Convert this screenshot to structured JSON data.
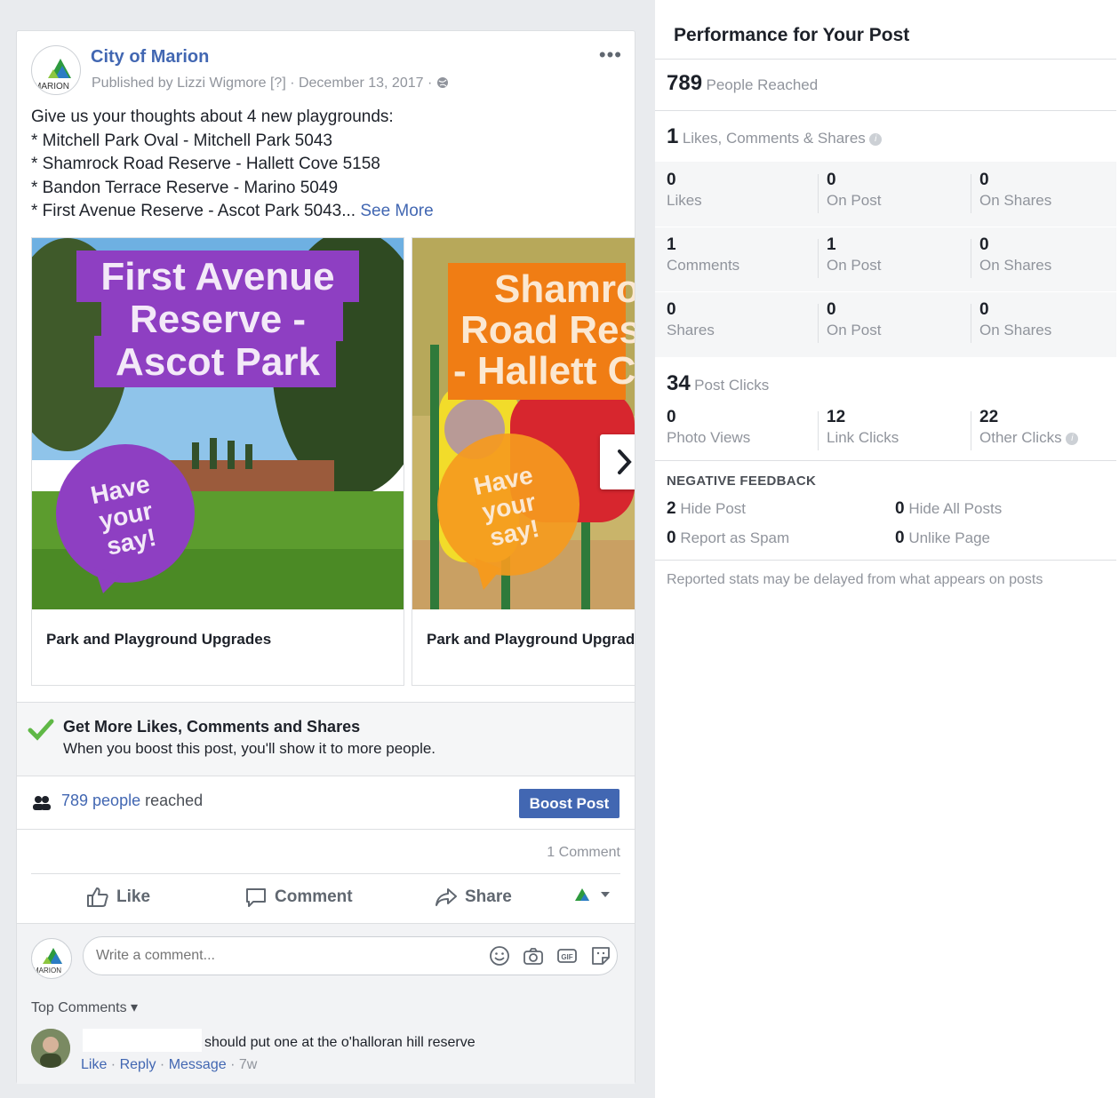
{
  "post": {
    "page_name": "City of Marion",
    "byline": "Published by Lizzi Wigmore [?] · December 13, 2017 ·",
    "avatar_text": "MARION",
    "menu_glyph": "•••",
    "body_lines": [
      "Give us your thoughts about 4 new playgrounds:",
      "* Mitchell Park Oval - Mitchell Park 5043",
      "* Shamrock Road Reserve - Hallett Cove 5158",
      "* Bandon Terrace Reserve - Marino 5049",
      "* First Avenue Reserve - Ascot Park 5043..."
    ],
    "see_more": "See More",
    "cards": [
      {
        "title_lines": [
          "First Avenue",
          "Reserve -",
          "Ascot Park"
        ],
        "bubble_lines": [
          "Have",
          "your",
          "say!"
        ],
        "caption": "Park and Playground Upgrades"
      },
      {
        "title_lines": [
          "Shamrock",
          "Road Reserve",
          "- Hallett Cove"
        ],
        "bubble_lines": [
          "Have",
          "your",
          "say!"
        ],
        "caption": "Park and Playground Upgrades"
      }
    ],
    "promo": {
      "title": "Get More Likes, Comments and Shares",
      "desc": "When you boost this post, you'll show it to more people."
    },
    "reach": {
      "link": "789 people",
      "suffix": " reached",
      "boost_label": "Boost Post"
    },
    "comment_count": "1 Comment",
    "actions": {
      "like": "Like",
      "comment": "Comment",
      "share": "Share"
    },
    "comment_input_placeholder": "Write a comment...",
    "top_comments": "Top Comments ▾",
    "comment": {
      "text": "should put one at the o'halloran hill reserve",
      "like": "Like",
      "reply": "Reply",
      "message": "Message",
      "age": "7w"
    },
    "colors": {
      "brand": "#4267b2",
      "card1_banner": "#8e3fc2",
      "card2_banner": "#f07d14",
      "check": "#5fb846"
    }
  },
  "performance": {
    "title": "Performance for Your Post",
    "reached": {
      "value": "789",
      "label": "People Reached"
    },
    "engagement": {
      "value": "1",
      "label": "Likes, Comments & Shares"
    },
    "rows": [
      {
        "a_num": "0",
        "a_lab": "Likes",
        "b_num": "0",
        "b_lab": "On Post",
        "c_num": "0",
        "c_lab": "On Shares"
      },
      {
        "a_num": "1",
        "a_lab": "Comments",
        "b_num": "1",
        "b_lab": "On Post",
        "c_num": "0",
        "c_lab": "On Shares"
      },
      {
        "a_num": "0",
        "a_lab": "Shares",
        "b_num": "0",
        "b_lab": "On Post",
        "c_num": "0",
        "c_lab": "On Shares"
      }
    ],
    "clicks": {
      "value": "34",
      "label": "Post Clicks"
    },
    "click_row": {
      "a_num": "0",
      "a_lab": "Photo Views",
      "b_num": "12",
      "b_lab": "Link Clicks",
      "c_num": "22",
      "c_lab": "Other Clicks"
    },
    "negative": {
      "title": "NEGATIVE FEEDBACK",
      "hide_post": {
        "num": "2",
        "lab": "Hide Post"
      },
      "hide_all": {
        "num": "0",
        "lab": "Hide All Posts"
      },
      "spam": {
        "num": "0",
        "lab": "Report as Spam"
      },
      "unlike": {
        "num": "0",
        "lab": "Unlike Page"
      }
    },
    "footnote": "Reported stats may be delayed from what appears on posts"
  }
}
